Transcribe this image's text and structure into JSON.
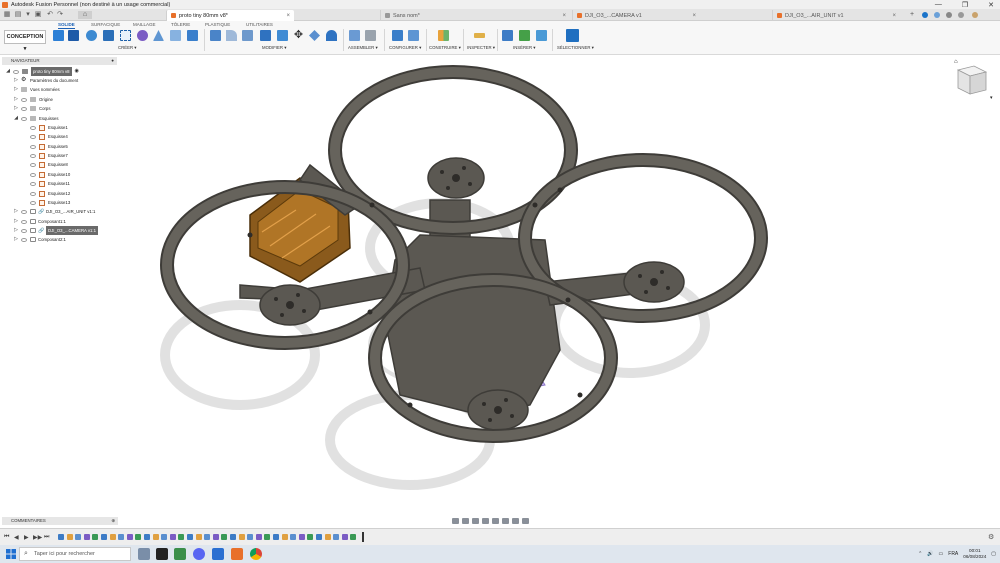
{
  "window": {
    "title": "Autodesk Fusion Personnel (non destiné à un usage commercial)",
    "controls": [
      "—",
      "❐",
      "✕"
    ]
  },
  "tabs": [
    {
      "label": "proto tiny 80mm v8*",
      "active": true
    },
    {
      "label": "Sans nom*",
      "active": false
    },
    {
      "label": "DJI_O3_...CAMERA v1",
      "active": false
    },
    {
      "label": "DJI_O3_...AIR_UNIT v1",
      "active": false
    }
  ],
  "ribbon": {
    "workspace": "CONCEPTION ▾",
    "tabs": [
      "SOLIDE",
      "SURFACIQUE",
      "MAILLAGE",
      "TÔLERIE",
      "PLASTIQUE",
      "UTILITAIRES"
    ],
    "groups": [
      "CRÉER ▾",
      "MODIFIER ▾",
      "ASSEMBLER ▾",
      "CONFIGURER ▾",
      "CONSTRUIRE ▾",
      "INSPECTER ▾",
      "INSÉRER ▾",
      "SÉLECTIONNER ▾"
    ]
  },
  "navigator": {
    "title": "NAVIGATEUR",
    "root": "proto tiny 80mm v8",
    "items": [
      {
        "label": "Paramètres du document",
        "level": 1,
        "type": "gear"
      },
      {
        "label": "Vues nommées",
        "level": 1,
        "type": "folder"
      },
      {
        "label": "Origine",
        "level": 1,
        "type": "folder"
      },
      {
        "label": "Corps",
        "level": 1,
        "type": "folder"
      },
      {
        "label": "Esquisses",
        "level": 1,
        "type": "folder",
        "expanded": true
      }
    ],
    "sketches": [
      "Esquisse1",
      "Esquisse4",
      "Esquisse5",
      "Esquisse7",
      "Esquisse8",
      "Esquisse10",
      "Esquisse11",
      "Esquisse12",
      "Esquisse13"
    ],
    "components": [
      {
        "label": "DJI_O3_...AIR_UNIT v1:1",
        "linked": true,
        "highlighted": false
      },
      {
        "label": "Composant1:1",
        "linked": false,
        "highlighted": false
      },
      {
        "label": "DJI_O3_...CAMERA v1:1",
        "linked": true,
        "highlighted": true
      },
      {
        "label": "Composant2:1",
        "linked": false,
        "highlighted": false
      }
    ]
  },
  "comments": {
    "title": "COMMENTAIRES"
  },
  "taskbar": {
    "search_placeholder": "Taper ici pour rechercher",
    "lang": "FRA",
    "time": "00:01",
    "date": "06/08/2024"
  },
  "colors": {
    "frame": "#5b5852",
    "frame_edge": "#3e3c38",
    "camera": "#8a5a1c",
    "battery": "#b7a3e8",
    "accent": "#1a5fb4"
  }
}
